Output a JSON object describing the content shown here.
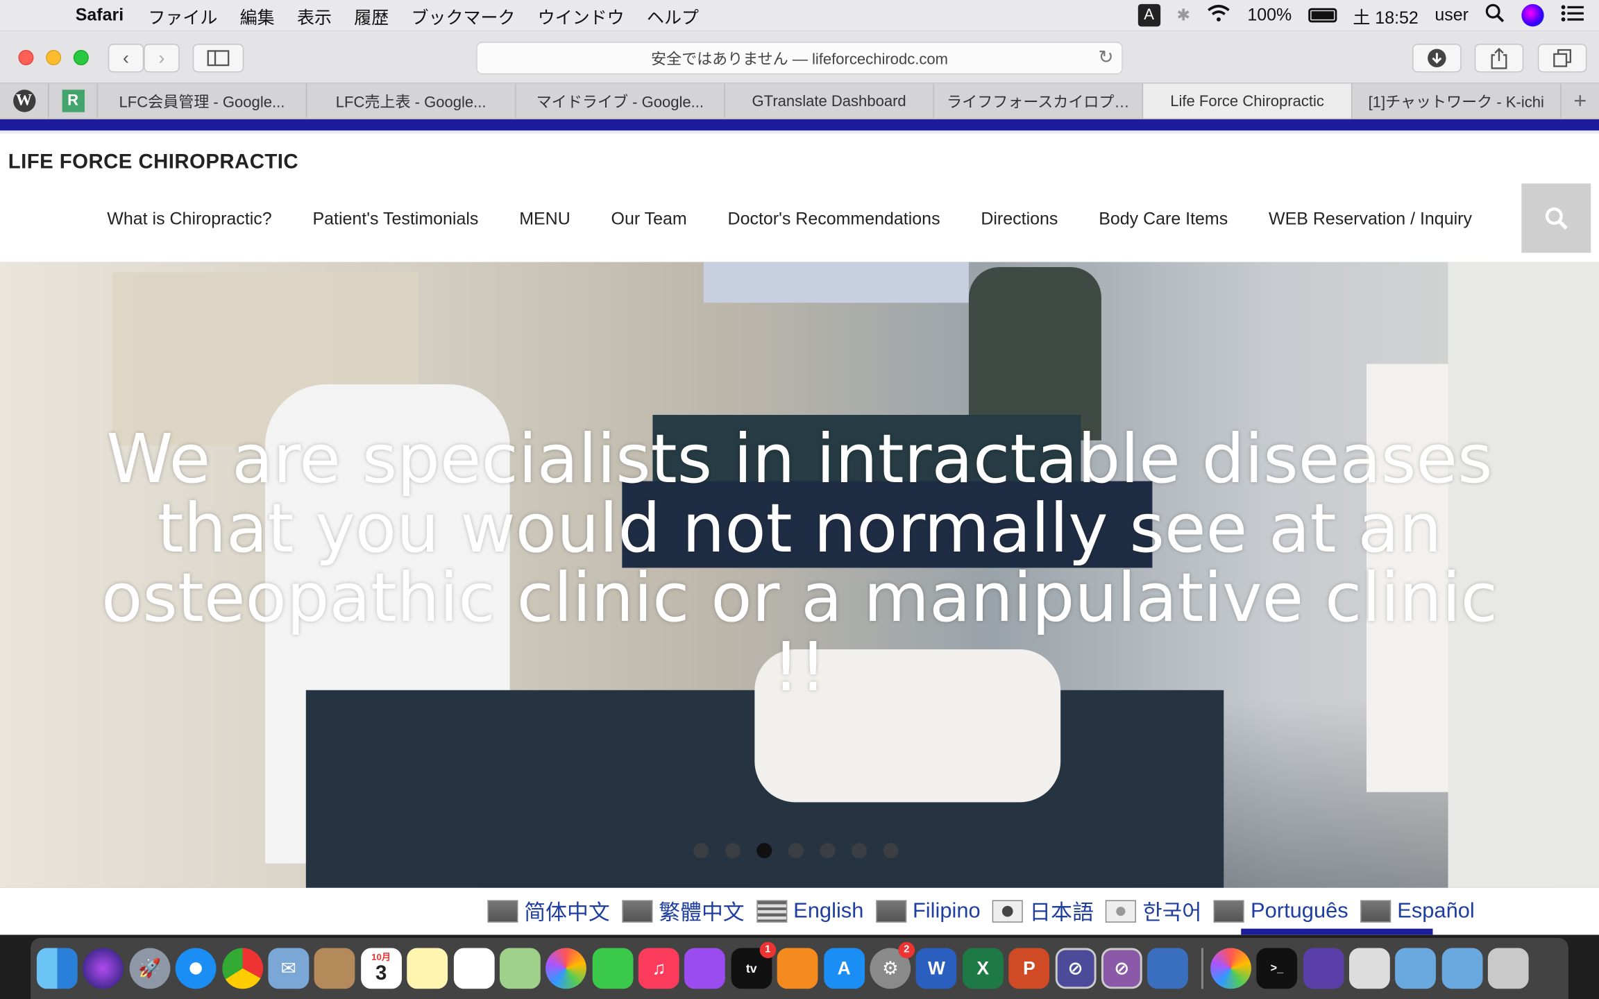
{
  "menubar": {
    "app": "Safari",
    "items": [
      "ファイル",
      "編集",
      "表示",
      "履歴",
      "ブックマーク",
      "ウインドウ",
      "ヘルプ"
    ],
    "ime": "A",
    "battery": "100%",
    "clock": "土 18:52",
    "user": "user"
  },
  "toolbar": {
    "url": "安全ではありません — lifeforcechirodc.com"
  },
  "tabs": [
    "LFC会員管理 - Google...",
    "LFC売上表 - Google...",
    "マイドライブ - Google...",
    "GTranslate Dashboard",
    "ライフフォースカイロプ…",
    "Life Force Chiropractic",
    "[1]チャットワーク - K-ichi"
  ],
  "site": {
    "title": "LIFE FORCE CHIROPRACTIC",
    "nav": [
      "What is Chiropractic?",
      "Patient's Testimonials",
      "MENU",
      "Our Team",
      "Doctor's Recommendations",
      "Directions",
      "Body Care Items",
      "WEB Reservation / Inquiry"
    ],
    "hero_line1": "We are specialists in intractable diseases",
    "hero_line2": "that you would not normally see at an",
    "hero_line3": "osteopathic clinic or a manipulative clinic !!",
    "languages": [
      "简体中文",
      "繁體中文",
      "English",
      "Filipino",
      "日本語",
      "한국어",
      "Português",
      "Español"
    ]
  },
  "dock": {
    "calendar_day": "3",
    "calendar_month": "10月",
    "badges": {
      "tv": "1",
      "prefs": "2"
    }
  }
}
